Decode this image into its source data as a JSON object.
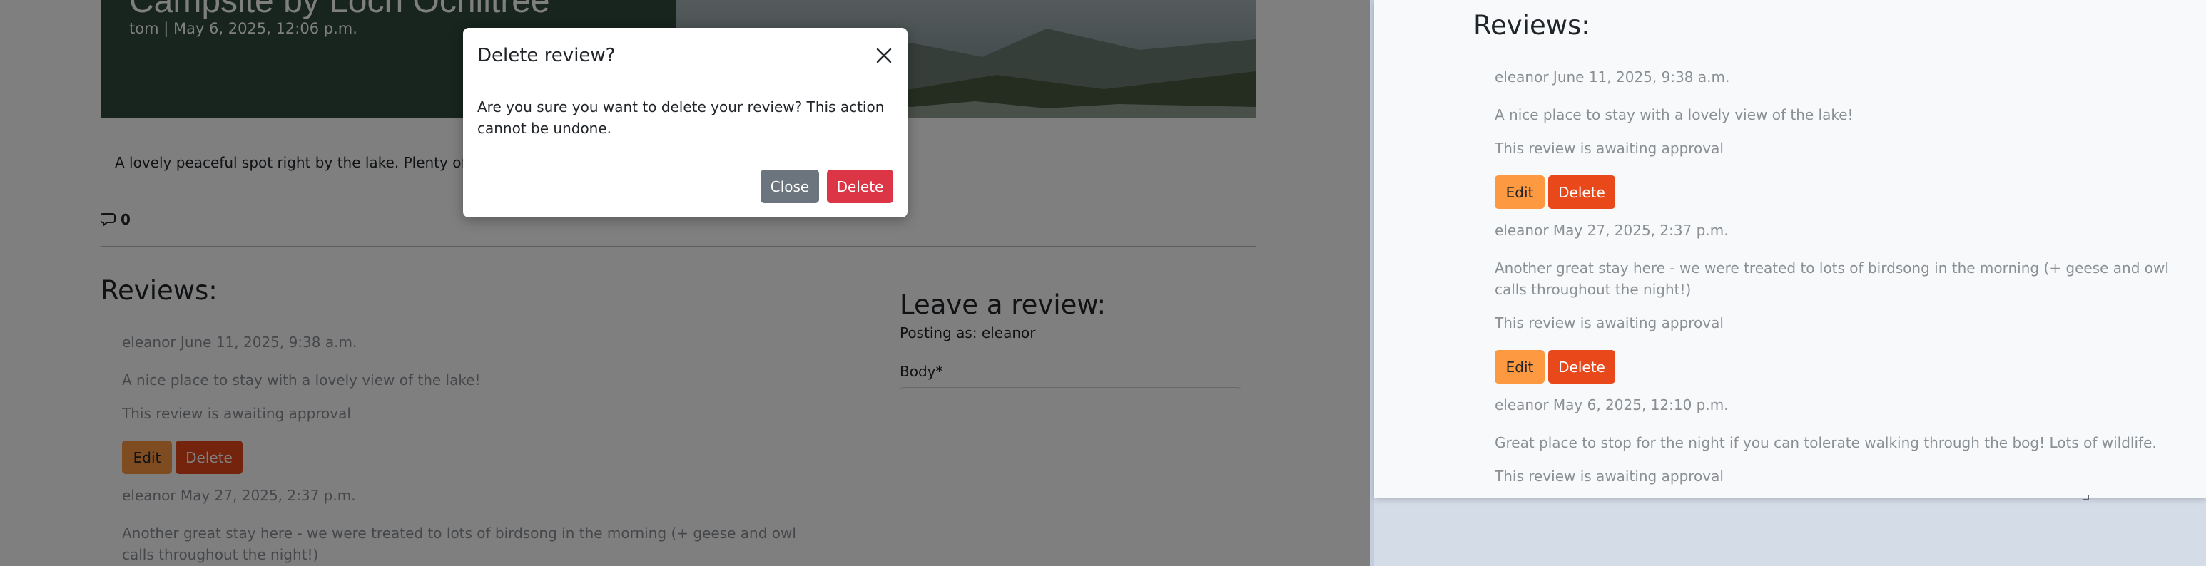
{
  "post": {
    "title": "Campsite by Loch Ochiltree",
    "meta": "tom | May 6, 2025, 12:06 p.m.",
    "body": "A lovely peaceful spot right by the lake. Plenty of flat",
    "comment_count": "0"
  },
  "left_reviews": {
    "title": "Reviews:",
    "items": [
      {
        "meta": "eleanor June 11, 2025, 9:38 a.m.",
        "text": "A nice place to stay with a lovely view of the lake!",
        "status": "This review is awaiting approval",
        "edit_label": "Edit",
        "delete_label": "Delete"
      },
      {
        "meta": "eleanor May 27, 2025, 2:37 p.m.",
        "text": "Another great stay here - we were treated to lots of birdsong in the morning (+ geese and owl calls throughout the night!)"
      }
    ]
  },
  "leave_review": {
    "title": "Leave a review:",
    "posting_as": "Posting as: eleanor",
    "body_label": "Body*"
  },
  "modal": {
    "title": "Delete review?",
    "body": "Are you sure you want to delete your review? This action cannot be undone.",
    "close_label": "Close",
    "delete_label": "Delete"
  },
  "right_reviews": {
    "title": "Reviews:",
    "items": [
      {
        "meta": "eleanor June 11, 2025, 9:38 a.m.",
        "text": "A nice place to stay with a lovely view of the lake!",
        "status": "This review is awaiting approval",
        "edit_label": "Edit",
        "delete_label": "Delete"
      },
      {
        "meta": "eleanor May 27, 2025, 2:37 p.m.",
        "text": "Another great stay here - we were treated to lots of birdsong in the morning (+ geese and owl calls throughout the night!)",
        "status": "This review is awaiting approval",
        "edit_label": "Edit",
        "delete_label": "Delete"
      },
      {
        "meta": "eleanor May 6, 2025, 12:10 p.m.",
        "text": "Great place to stop for the night if you can tolerate walking through the bog! Lots of wildlife.",
        "status": "This review is awaiting approval"
      }
    ]
  },
  "colors": {
    "edit_button": "#fd9941",
    "delete_button": "#e9481a",
    "modal_delete": "#dc3545",
    "modal_close": "#6c757d"
  }
}
